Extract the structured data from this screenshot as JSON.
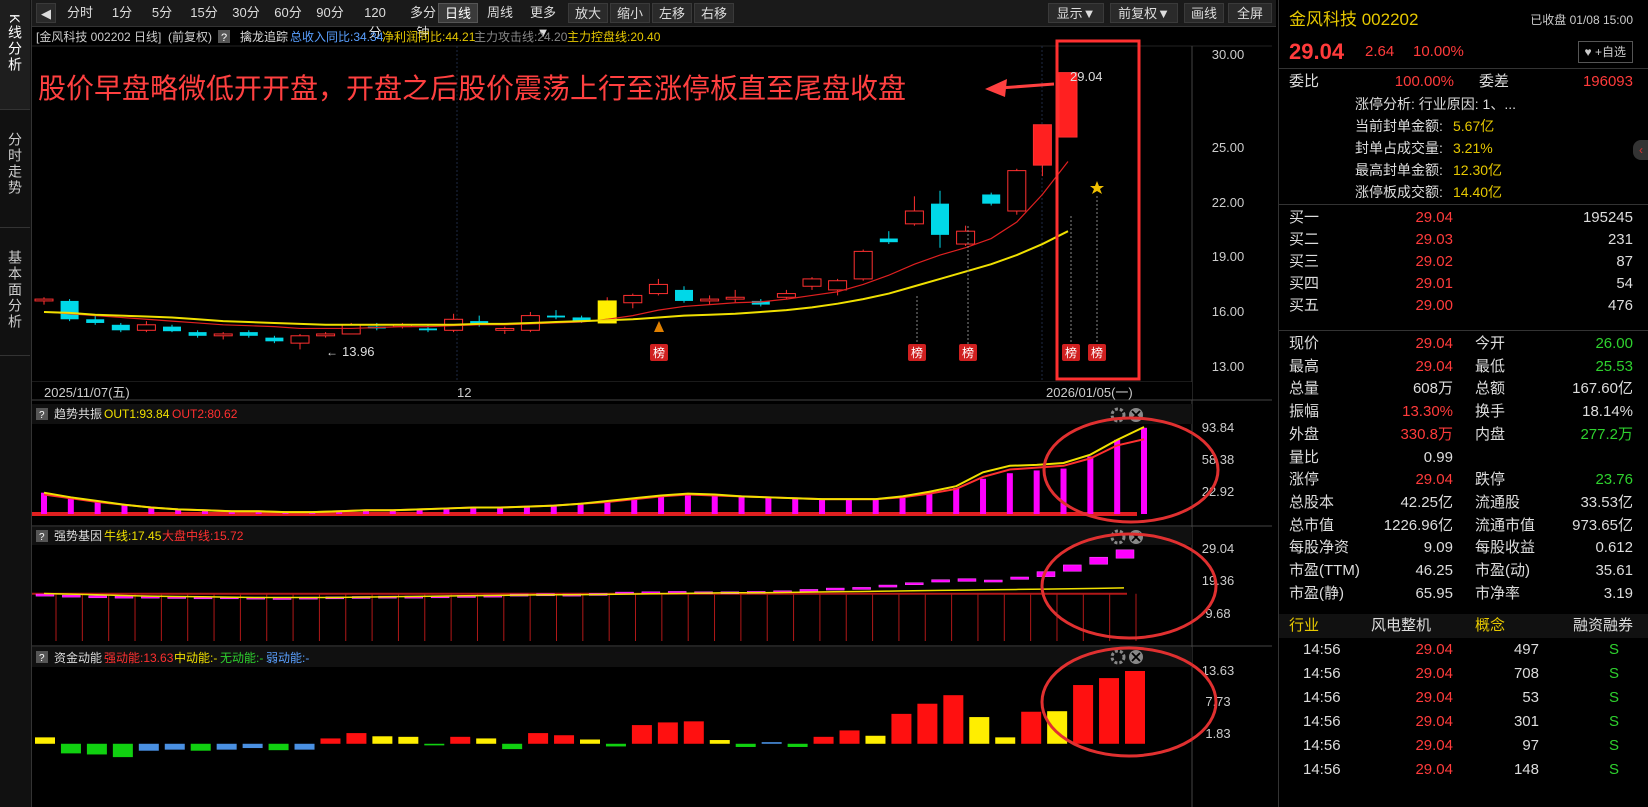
{
  "nav_tabs": [
    "K线分析",
    "分时走势",
    "基本面分析"
  ],
  "toolbar": {
    "items": [
      "分时",
      "1分",
      "5分",
      "15分",
      "30分",
      "60分",
      "90分",
      "120分",
      "多分钟",
      "日线",
      "周线",
      "更多▼",
      "放大",
      "缩小",
      "左移",
      "右移"
    ],
    "active": "日线",
    "right_items": [
      "显示▼",
      "前复权▼",
      "画线",
      "全屏"
    ]
  },
  "chart_header": {
    "title": "[金风科技 002202 日线]",
    "adjust": "(前复权)",
    "help": "?",
    "indicator": "擒龙追踪",
    "rev": "总收入同比:34.34",
    "profit": "净利润同比:44.21",
    "attack": "主力攻击线:24.20",
    "control": "主力控盘线:20.40"
  },
  "annotation": "股价早盘略微低开开盘，开盘之后股价震荡上行至涨停板直至尾盘收盘",
  "main_axis": [
    "30.00",
    "25.00",
    "22.00",
    "19.00",
    "16.00",
    "13.00"
  ],
  "date_axis": [
    "2025/11/07(五)",
    "12",
    "2026/01/05(一)"
  ],
  "price_labels": {
    "high": "29.04",
    "low": "13.96"
  },
  "badge": "榜",
  "sub1": {
    "name": "趋势共振",
    "out1": "OUT1:93.84",
    "out2": "OUT2:80.62",
    "axis": [
      "93.84",
      "58.38",
      "22.92"
    ]
  },
  "sub2": {
    "name": "强势基因",
    "bull": "牛线:17.45",
    "market": "大盘中线:15.72",
    "axis": [
      "29.04",
      "19.36",
      "9.68"
    ]
  },
  "sub3": {
    "name": "资金动能",
    "strong": "强动能:13.63",
    "mid": "中动能:-",
    "none": "无动能:-",
    "weak": "弱动能:-",
    "axis": [
      "13.63",
      "7.73",
      "1.83"
    ]
  },
  "chart_data": {
    "type": "candlestick",
    "candles": [
      [
        16.6,
        16.8,
        16.4,
        16.7
      ],
      [
        16.6,
        16.7,
        15.5,
        15.6
      ],
      [
        15.6,
        15.8,
        15.3,
        15.4
      ],
      [
        15.3,
        15.4,
        14.9,
        15.0
      ],
      [
        15.0,
        15.5,
        14.9,
        15.3
      ],
      [
        15.2,
        15.3,
        14.9,
        14.95
      ],
      [
        14.9,
        15.0,
        14.6,
        14.7
      ],
      [
        14.7,
        14.9,
        14.5,
        14.8
      ],
      [
        14.9,
        15.0,
        14.6,
        14.7
      ],
      [
        14.6,
        14.7,
        14.3,
        14.4
      ],
      [
        14.3,
        14.8,
        13.96,
        14.7
      ],
      [
        14.7,
        14.9,
        14.6,
        14.8
      ],
      [
        14.8,
        15.4,
        14.8,
        15.3
      ],
      [
        15.2,
        15.4,
        15.0,
        15.1
      ],
      [
        15.2,
        15.4,
        15.1,
        15.3
      ],
      [
        15.1,
        15.3,
        14.9,
        15.0
      ],
      [
        15.0,
        15.9,
        14.9,
        15.6
      ],
      [
        15.5,
        15.8,
        15.2,
        15.3
      ],
      [
        15.0,
        15.2,
        14.8,
        15.1
      ],
      [
        15.0,
        16.0,
        14.9,
        15.8
      ],
      [
        15.8,
        16.1,
        15.6,
        15.7
      ],
      [
        15.7,
        15.8,
        15.4,
        15.5
      ],
      [
        15.4,
        16.8,
        15.4,
        16.6
      ],
      [
        16.5,
        17.0,
        16.2,
        16.9
      ],
      [
        17.0,
        17.8,
        16.9,
        17.5
      ],
      [
        17.2,
        17.4,
        16.5,
        16.6
      ],
      [
        16.6,
        16.9,
        16.4,
        16.7
      ],
      [
        16.7,
        17.2,
        16.5,
        16.8
      ],
      [
        16.6,
        16.7,
        16.3,
        16.4
      ],
      [
        16.8,
        17.2,
        16.7,
        17.0
      ],
      [
        17.4,
        17.9,
        17.2,
        17.8
      ],
      [
        17.2,
        17.8,
        16.9,
        17.7
      ],
      [
        17.8,
        19.4,
        17.7,
        19.3
      ],
      [
        20.0,
        20.4,
        19.7,
        19.8
      ],
      [
        20.8,
        22.3,
        20.7,
        21.5
      ],
      [
        21.9,
        22.6,
        19.5,
        20.2
      ],
      [
        19.7,
        20.7,
        19.6,
        20.4
      ],
      [
        22.4,
        22.5,
        21.8,
        21.9
      ],
      [
        21.5,
        23.8,
        21.3,
        23.7
      ],
      [
        24.0,
        26.2,
        23.4,
        26.2
      ],
      [
        25.53,
        29.04,
        25.53,
        29.04
      ]
    ],
    "ma_attack": [
      16.0,
      15.9,
      15.8,
      15.7,
      15.6,
      15.5,
      15.4,
      15.3,
      15.25,
      15.2,
      15.1,
      15.1,
      15.1,
      15.15,
      15.2,
      15.2,
      15.25,
      15.3,
      15.3,
      15.35,
      15.4,
      15.45,
      15.6,
      15.8,
      16.1,
      16.3,
      16.4,
      16.5,
      16.55,
      16.7,
      16.9,
      17.1,
      17.5,
      18.0,
      18.6,
      19.1,
      19.5,
      20.0,
      20.9,
      22.4,
      24.2
    ],
    "ma_control": [
      16.0,
      15.95,
      15.85,
      15.8,
      15.75,
      15.7,
      15.6,
      15.5,
      15.45,
      15.4,
      15.35,
      15.3,
      15.3,
      15.3,
      15.3,
      15.3,
      15.3,
      15.35,
      15.35,
      15.4,
      15.45,
      15.5,
      15.55,
      15.6,
      15.7,
      15.8,
      15.85,
      15.9,
      16.0,
      16.1,
      16.25,
      16.45,
      16.7,
      17.0,
      17.4,
      17.8,
      18.2,
      18.6,
      19.1,
      19.7,
      20.4
    ],
    "sub1_bars": [
      23,
      18,
      14,
      10,
      7,
      5,
      4,
      3,
      3,
      2,
      2,
      3,
      4,
      4,
      5,
      6,
      7,
      7,
      8,
      9,
      11,
      14,
      17,
      20,
      22,
      21,
      19,
      18,
      17,
      16,
      16,
      16,
      19,
      24,
      28,
      38,
      44,
      47,
      49,
      62,
      80,
      93
    ],
    "sub1_out1": [
      23,
      18,
      14,
      10,
      7,
      5,
      4,
      3,
      3,
      2,
      2,
      3,
      4,
      4,
      5,
      6,
      7,
      7,
      8,
      9,
      11,
      14,
      17,
      20,
      22,
      21,
      19,
      18,
      17,
      16,
      16,
      16,
      19,
      24,
      30,
      45,
      52,
      53,
      55,
      64,
      80,
      93.84
    ],
    "sub1_out2": [
      21,
      17,
      13,
      10,
      7,
      5,
      4,
      3,
      3,
      2,
      2,
      3,
      4,
      4,
      5,
      6,
      7,
      7,
      8,
      9,
      11,
      13,
      16,
      19,
      21,
      20,
      19,
      18,
      17,
      16,
      16,
      16,
      18,
      22,
      27,
      40,
      48,
      50,
      52,
      60,
      74,
      80.62
    ],
    "sub2_boxes": [
      [
        15.6,
        15.4
      ],
      [
        15.3,
        15.0
      ],
      [
        15.1,
        14.9
      ],
      [
        15.0,
        14.9
      ],
      [
        14.9,
        15.0
      ],
      [
        14.9,
        14.8
      ],
      [
        14.8,
        14.7
      ],
      [
        14.8,
        14.6
      ],
      [
        14.7,
        14.6
      ],
      [
        14.6,
        14.5
      ],
      [
        14.7,
        14.5
      ],
      [
        14.8,
        14.7
      ],
      [
        14.9,
        14.7
      ],
      [
        15.0,
        14.9
      ],
      [
        15.0,
        14.9
      ],
      [
        15.1,
        15.0
      ],
      [
        15.2,
        15.0
      ],
      [
        15.3,
        15.2
      ],
      [
        15.6,
        15.3
      ],
      [
        15.7,
        15.4
      ],
      [
        15.6,
        15.4
      ],
      [
        15.8,
        15.5
      ],
      [
        16.2,
        15.8
      ],
      [
        16.3,
        15.9
      ],
      [
        16.4,
        16.1
      ],
      [
        16.3,
        16.0
      ],
      [
        16.3,
        16.1
      ],
      [
        16.4,
        16.2
      ],
      [
        16.6,
        16.3
      ],
      [
        17.0,
        16.5
      ],
      [
        17.4,
        16.9
      ],
      [
        17.6,
        17.2
      ],
      [
        18.3,
        17.7
      ],
      [
        19.0,
        18.4
      ],
      [
        19.9,
        19.2
      ],
      [
        20.2,
        19.4
      ],
      [
        19.8,
        19.2
      ],
      [
        20.7,
        20.0
      ],
      [
        22.3,
        20.8
      ],
      [
        24.3,
        22.4
      ],
      [
        26.6,
        24.5
      ],
      [
        28.8,
        26.3
      ]
    ],
    "sub2_bull": [
      15.8,
      15.6,
      15.4,
      15.2,
      15.0,
      14.9,
      14.8,
      14.7,
      14.6,
      14.6,
      14.6,
      14.6,
      14.7,
      14.8,
      14.9,
      15.0,
      15.1,
      15.2,
      15.3,
      15.4,
      15.4,
      15.5,
      15.6,
      15.7,
      15.8,
      15.9,
      16.0,
      16.0,
      16.1,
      16.2,
      16.3,
      16.4,
      16.5,
      16.6,
      16.7,
      16.8,
      16.9,
      17.0,
      17.1,
      17.2,
      17.3,
      17.45
    ],
    "sub2_market": [
      15.72
    ],
    "sub3_values": [
      1.2,
      -1.8,
      -2.0,
      -2.5,
      -1.3,
      -1.1,
      -1.3,
      -1.1,
      -0.8,
      -1.2,
      -1.1,
      1.0,
      2.0,
      1.4,
      1.3,
      -0.3,
      1.3,
      1.0,
      -1.0,
      2.0,
      1.6,
      0.8,
      -0.5,
      3.5,
      4.0,
      4.2,
      0.7,
      -0.6,
      0.3,
      -0.6,
      1.3,
      2.5,
      1.5,
      5.6,
      7.5,
      9.1,
      5.0,
      1.2,
      6.0,
      6.1,
      11.0,
      12.3,
      13.63
    ],
    "sub3_colors": [
      "y",
      "g",
      "g",
      "g",
      "b",
      "b",
      "g",
      "b",
      "b",
      "g",
      "b",
      "r",
      "r",
      "y",
      "y",
      "g",
      "r",
      "y",
      "g",
      "r",
      "r",
      "y",
      "g",
      "r",
      "r",
      "r",
      "y",
      "g",
      "b",
      "g",
      "r",
      "r",
      "y",
      "r",
      "r",
      "r",
      "y",
      "y",
      "r",
      "y",
      "r",
      "r",
      "r"
    ]
  },
  "stock": {
    "name": "金风科技 002202",
    "status": "已收盘 01/08 15:00",
    "price": "29.04",
    "change": "2.64",
    "pct": "10.00%",
    "self_select": "+自选",
    "weibi_label": "委比",
    "weibi": "100.00%",
    "weicha_label": "委差",
    "weicha": "196093",
    "limit_analysis": "涨停分析:  行业原因: 1、...",
    "seal_amt_label": "当前封单金额:",
    "seal_amt": "5.67亿",
    "seal_vol_label": "封单占成交量:",
    "seal_vol": "3.21%",
    "max_seal_label": "最高封单金额:",
    "max_seal": "12.30亿",
    "limit_turn_label": "涨停板成交额:",
    "limit_turn": "14.40亿",
    "buys": [
      {
        "label": "买一",
        "price": "29.04",
        "vol": "195245"
      },
      {
        "label": "买二",
        "price": "29.03",
        "vol": "231"
      },
      {
        "label": "买三",
        "price": "29.02",
        "vol": "87"
      },
      {
        "label": "买四",
        "price": "29.01",
        "vol": "54"
      },
      {
        "label": "买五",
        "price": "29.00",
        "vol": "476"
      }
    ],
    "quote_rows": [
      [
        {
          "l": "现价",
          "v": "29.04",
          "c": "red"
        },
        {
          "l": "今开",
          "v": "26.00",
          "c": "green"
        }
      ],
      [
        {
          "l": "最高",
          "v": "29.04",
          "c": "red"
        },
        {
          "l": "最低",
          "v": "25.53",
          "c": "green"
        }
      ],
      [
        {
          "l": "总量",
          "v": "608万",
          "c": "white"
        },
        {
          "l": "总额",
          "v": "167.60亿",
          "c": "white"
        }
      ],
      [
        {
          "l": "振幅",
          "v": "13.30%",
          "c": "red"
        },
        {
          "l": "换手",
          "v": "18.14%",
          "c": "white"
        }
      ],
      [
        {
          "l": "外盘",
          "v": "330.8万",
          "c": "red"
        },
        {
          "l": "内盘",
          "v": "277.2万",
          "c": "green"
        }
      ],
      [
        {
          "l": "量比",
          "v": "0.99",
          "c": "white"
        },
        {
          "l": "",
          "v": "",
          "c": "white"
        }
      ],
      [
        {
          "l": "涨停",
          "v": "29.04",
          "c": "red"
        },
        {
          "l": "跌停",
          "v": "23.76",
          "c": "green"
        }
      ],
      [
        {
          "l": "总股本",
          "v": "42.25亿",
          "c": "white"
        },
        {
          "l": "流通股",
          "v": "33.53亿",
          "c": "white"
        }
      ],
      [
        {
          "l": "总市值",
          "v": "1226.96亿",
          "c": "white"
        },
        {
          "l": "流通市值",
          "v": "973.65亿",
          "c": "white"
        }
      ],
      [
        {
          "l": "每股净资",
          "v": "9.09",
          "c": "white"
        },
        {
          "l": "每股收益",
          "v": "0.612",
          "c": "white"
        }
      ],
      [
        {
          "l": "市盈(TTM)",
          "v": "46.25",
          "c": "white"
        },
        {
          "l": "市盈(动)",
          "v": "35.61",
          "c": "white"
        }
      ],
      [
        {
          "l": "市盈(静)",
          "v": "65.95",
          "c": "white"
        },
        {
          "l": "市净率",
          "v": "3.19",
          "c": "white"
        }
      ]
    ],
    "industry_label": "行业",
    "industry": "风电整机",
    "concept_label": "概念",
    "margin": "融资融券",
    "trades": [
      {
        "t": "14:56",
        "p": "29.04",
        "v": "497",
        "s": "S"
      },
      {
        "t": "14:56",
        "p": "29.04",
        "v": "708",
        "s": "S"
      },
      {
        "t": "14:56",
        "p": "29.04",
        "v": "53",
        "s": "S"
      },
      {
        "t": "14:56",
        "p": "29.04",
        "v": "301",
        "s": "S"
      },
      {
        "t": "14:56",
        "p": "29.04",
        "v": "97",
        "s": "S"
      },
      {
        "t": "14:56",
        "p": "29.04",
        "v": "148",
        "s": "S"
      }
    ]
  }
}
